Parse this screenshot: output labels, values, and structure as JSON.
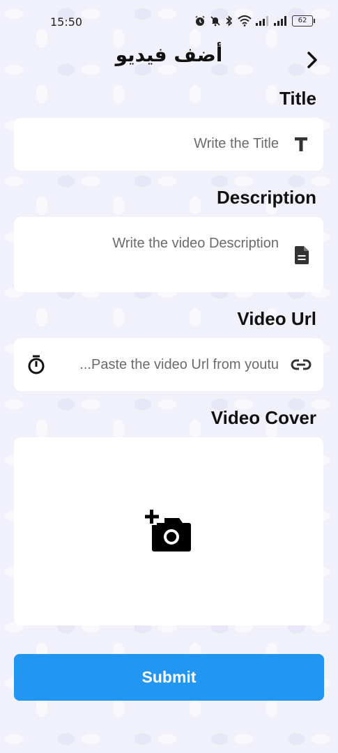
{
  "status_bar": {
    "time": "15:50",
    "battery": "62",
    "icons": [
      "alarm-icon",
      "mute-icon",
      "bluetooth-icon",
      "wifi-icon",
      "signal-icon",
      "signal-icon",
      "battery-icon"
    ]
  },
  "header": {
    "title": "أضف فيديو",
    "back_icon": "chevron-right-icon"
  },
  "form": {
    "title": {
      "label": "Title",
      "placeholder": "Write the Title",
      "icon": "text-format-icon"
    },
    "description": {
      "label": "Description",
      "placeholder": "Write the video Description",
      "icon": "document-icon"
    },
    "video_url": {
      "label": "Video Url",
      "placeholder": "...Paste the video Url from youtu",
      "leading_icon": "timer-icon",
      "trailing_icon": "link-icon"
    },
    "video_cover": {
      "label": "Video Cover",
      "icon": "add-photo-icon"
    }
  },
  "submit": {
    "label": "Submit",
    "color": "#2196f3"
  }
}
